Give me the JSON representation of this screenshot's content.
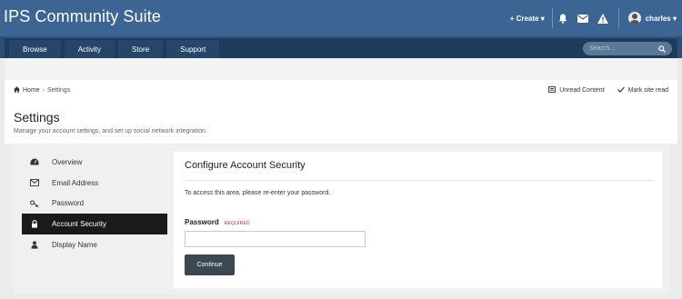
{
  "header": {
    "site_title": "IPS Community Suite",
    "create_label": "+ Create ▾",
    "user_label": "charles ▾"
  },
  "nav": {
    "tabs": [
      "Browse",
      "Activity",
      "Store",
      "Support"
    ],
    "search_placeholder": "Search..."
  },
  "breadcrumb": {
    "home": "Home",
    "separator": "›",
    "current": "Settings",
    "unread_label": "Unread Content",
    "mark_read_label": "Mark site read"
  },
  "page": {
    "title": "Settings",
    "subtitle": "Manage your account settings, and set up social network integration."
  },
  "sidebar": {
    "items": [
      {
        "label": "Overview",
        "icon": "dashboard-icon"
      },
      {
        "label": "Email Address",
        "icon": "envelope-icon"
      },
      {
        "label": "Password",
        "icon": "key-icon"
      },
      {
        "label": "Account Security",
        "icon": "lock-icon",
        "active": true
      },
      {
        "label": "Display Name",
        "icon": "user-icon"
      }
    ]
  },
  "panel": {
    "title": "Configure Account Security",
    "description": "To access this area, please re-enter your password.",
    "password_label": "Password",
    "required_label": "REQUIRED",
    "password_value": "",
    "continue_label": "Continue"
  },
  "colors": {
    "header_bg": "#3d6594",
    "nav_bg": "#1f3b5c",
    "active_item": "#1a1a1a",
    "button": "#3b4752",
    "required": "#b92c28"
  }
}
